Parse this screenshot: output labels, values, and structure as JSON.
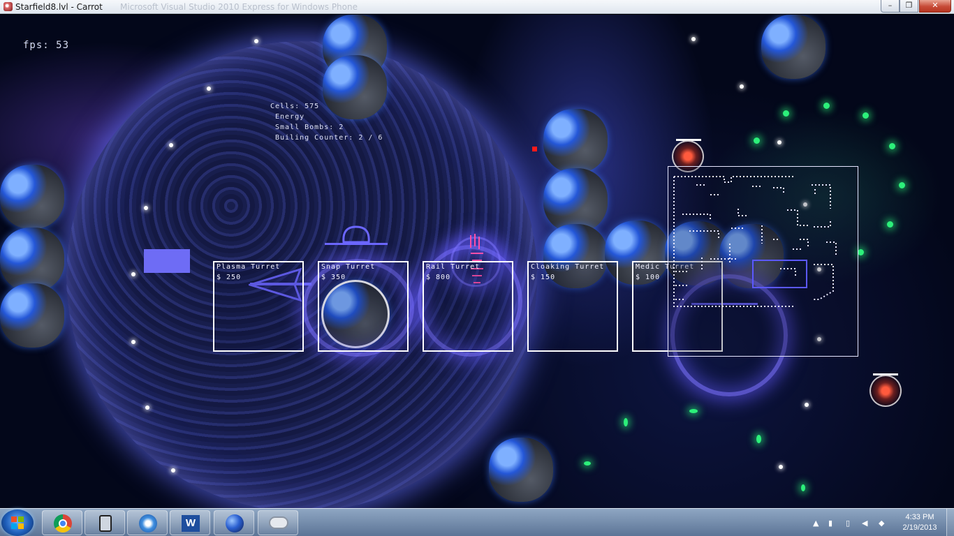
{
  "window": {
    "title": "Starfield8.lvl - Carrot",
    "title_suffix": "Microsoft Visual Studio 2010 Express for Windows Phone",
    "buttons": [
      "–",
      "❐",
      "✕"
    ]
  },
  "game": {
    "fps_label": "fps: 53",
    "hud": {
      "cells": "Cells: 575",
      "energy": "Energy",
      "small_bombs": "Small Bombs: 2",
      "building_counter": "Builing Counter: 2 / 6"
    },
    "build_menu": [
      {
        "name": "Plasma Turret",
        "cost": "$ 250"
      },
      {
        "name": "Snap Turret",
        "cost": "$ 350"
      },
      {
        "name": "Rail Turret",
        "cost": "$ 800"
      },
      {
        "name": "Cloaking Turret",
        "cost": "$ 150"
      },
      {
        "name": "Medic Turret",
        "cost": "$ 100"
      }
    ]
  },
  "taskbar": {
    "apps": [
      "chrome-icon",
      "windows-phone-emulator-icon",
      "itunes-icon",
      "word-icon",
      "game-icon",
      "xbox-controller-icon"
    ],
    "clock_time": "4:33 PM",
    "clock_date": "2/19/2013",
    "tray_icons": [
      "show-hidden-icons",
      "network-icon",
      "battery-icon",
      "volume-icon",
      "dropbox-icon"
    ]
  }
}
